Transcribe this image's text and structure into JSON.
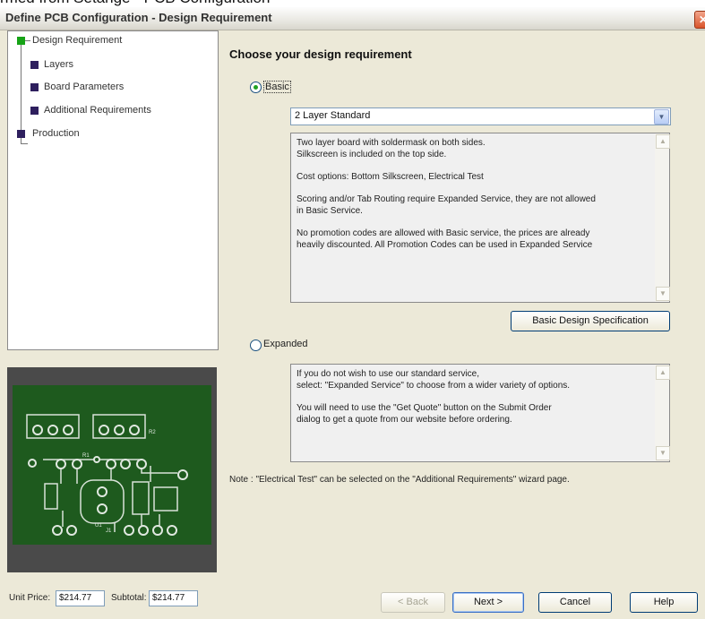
{
  "top_strip": "rmed from Setange - PCB Configuration",
  "window": {
    "title": "Define PCB Configuration - Design Requirement",
    "close_glyph": "✕"
  },
  "nav": {
    "items": [
      {
        "label": "Design Requirement"
      },
      {
        "label": "Layers"
      },
      {
        "label": "Board Parameters"
      },
      {
        "label": "Additional Requirements"
      },
      {
        "label": "Production"
      }
    ]
  },
  "main": {
    "heading": "Choose your design requirement",
    "basic": {
      "label": "Basic",
      "selected": true,
      "select_value": "2 Layer Standard",
      "description": [
        "Two layer board with soldermask on both sides.",
        "Silkscreen is included on the top side.",
        "Cost options:  Bottom Silkscreen,  Electrical Test",
        "Scoring and/or Tab Routing require Expanded Service, they are not allowed",
        "in Basic Service.",
        "No promotion codes are allowed with Basic service, the prices are already",
        "heavily discounted.  All Promotion Codes can be used in Expanded Service"
      ],
      "spec_button": "Basic Design Specification"
    },
    "expanded": {
      "label": "Expanded",
      "selected": false,
      "description": [
        "If you do not wish to use our standard service,",
        "select:  \"Expanded Service\" to choose from a wider variety of options.",
        "You will need to use the \"Get Quote\" button on the Submit Order",
        "dialog to get a quote from our website before ordering."
      ]
    },
    "note": "Note : \"Electrical Test\" can be selected on the \"Additional Requirements\" wizard page."
  },
  "footer": {
    "unit_price_label": "Unit Price:",
    "unit_price_value": "$214.77",
    "subtotal_label": "Subtotal:",
    "subtotal_value": "$214.77",
    "back": "< Back",
    "next": "Next >",
    "cancel": "Cancel",
    "help": "Help"
  },
  "colors": {
    "dialog_bg": "#ece9d8",
    "pcb_green": "#1e5a1e",
    "step_active": "#17a317",
    "step_inactive": "#2e1f5e",
    "radio_dot": "#21a121"
  }
}
